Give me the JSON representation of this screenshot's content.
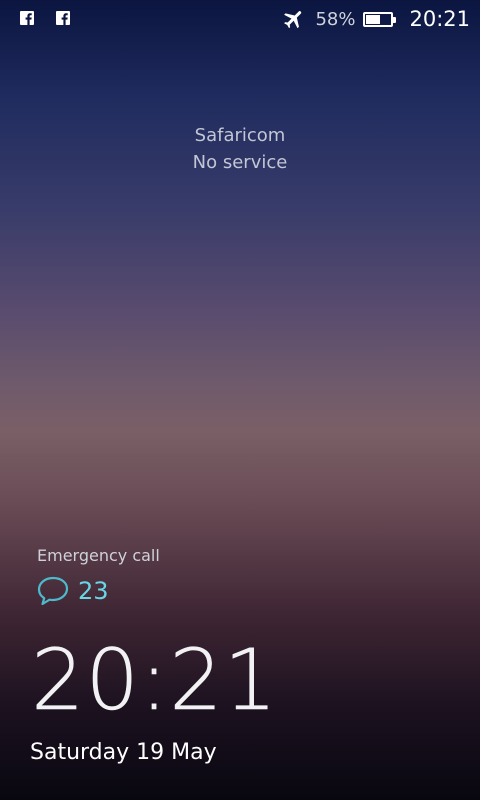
{
  "status_bar": {
    "notification_icons": [
      "facebook-icon",
      "facebook-icon"
    ],
    "airplane_mode_icon": "airplane-icon",
    "battery_percent": "58%",
    "battery_level": 0.58,
    "time": "20:21"
  },
  "carrier": {
    "name": "Safaricom",
    "status": "No service"
  },
  "emergency": {
    "label": "Emergency call"
  },
  "messages": {
    "icon": "chat-bubble-icon",
    "count": "23",
    "accent_color": "#67d6e6"
  },
  "clock": {
    "time": "20:21",
    "date": "Saturday 19 May"
  }
}
